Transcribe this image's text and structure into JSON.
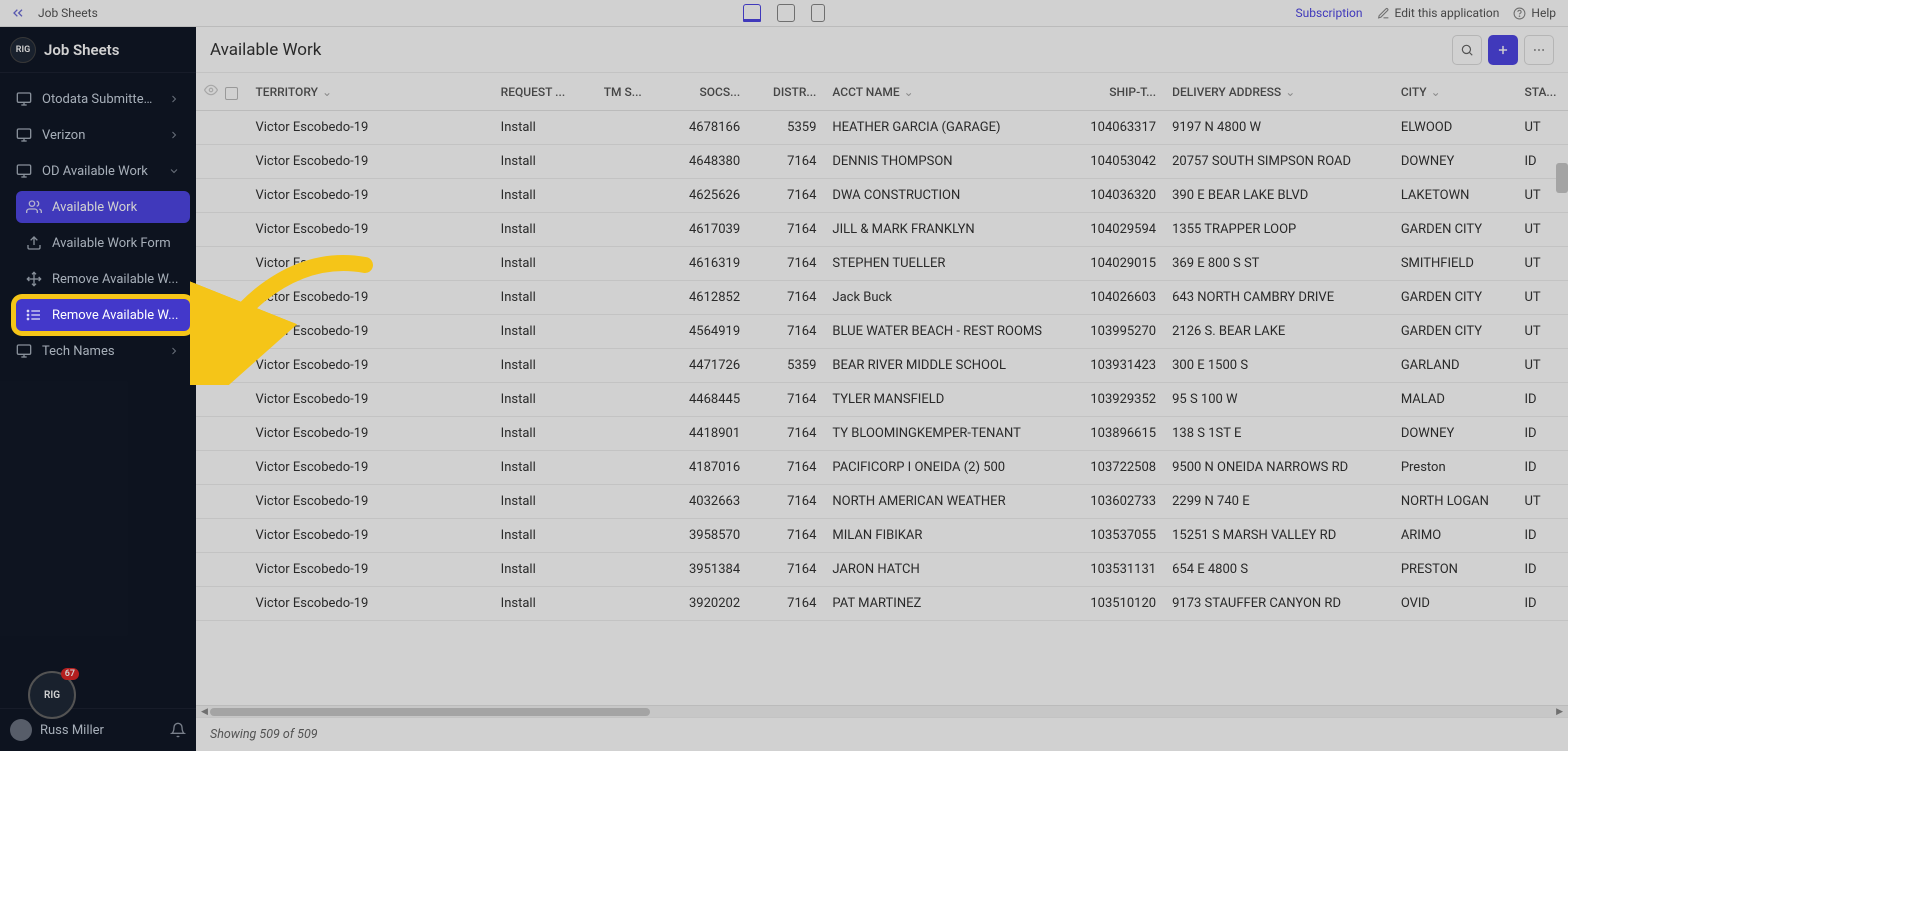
{
  "topbar": {
    "breadcrumb": "Job Sheets",
    "subscription": "Subscription",
    "edit": "Edit this application",
    "help": "Help"
  },
  "sidebar": {
    "logo_text": "RIG",
    "title": "Job Sheets",
    "items": [
      {
        "label": "Otodata Submitted ...",
        "icon": "monitor-icon",
        "has_chev": true
      },
      {
        "label": "Verizon",
        "icon": "monitor-icon",
        "has_chev": true
      },
      {
        "label": "OD Available Work",
        "icon": "monitor-icon",
        "has_chev": true,
        "expanded": true
      },
      {
        "label": "Available Work",
        "icon": "users-icon",
        "active": true,
        "indent": true
      },
      {
        "label": "Available Work Form",
        "icon": "upload-icon",
        "indent": true
      },
      {
        "label": "Remove Available W...",
        "icon": "move-icon",
        "indent": true
      },
      {
        "label": "Remove Available W...",
        "icon": "list-icon",
        "highlight": true,
        "indent": true
      },
      {
        "label": "Tech Names",
        "icon": "monitor-icon",
        "has_chev": true
      }
    ],
    "badge_count": "67",
    "badge_text": "RIG",
    "user_name": "Russ Miller"
  },
  "page": {
    "title": "Available Work",
    "footer": "Showing 509 of 509"
  },
  "columns": [
    "TERRITORY",
    "REQUEST ...",
    "TM S...",
    "SOCS...",
    "DISTR...",
    "ACCT NAME",
    "SHIP-T...",
    "DELIVERY ADDRESS",
    "CITY",
    "STA..."
  ],
  "rows": [
    {
      "territory": "Victor Escobedo-19",
      "request": "Install",
      "tms": "",
      "socs": "4678166",
      "distr": "5359",
      "acct": "HEATHER GARCIA (GARAGE)",
      "ship": "104063317",
      "addr": "9197 N 4800 W",
      "city": "ELWOOD",
      "sta": "UT"
    },
    {
      "territory": "Victor Escobedo-19",
      "request": "Install",
      "tms": "",
      "socs": "4648380",
      "distr": "7164",
      "acct": "DENNIS THOMPSON",
      "ship": "104053042",
      "addr": "20757 SOUTH SIMPSON ROAD",
      "city": "DOWNEY",
      "sta": "ID"
    },
    {
      "territory": "Victor Escobedo-19",
      "request": "Install",
      "tms": "",
      "socs": "4625626",
      "distr": "7164",
      "acct": "DWA CONSTRUCTION",
      "ship": "104036320",
      "addr": "390 E BEAR LAKE BLVD",
      "city": "LAKETOWN",
      "sta": "UT"
    },
    {
      "territory": "Victor Escobedo-19",
      "request": "Install",
      "tms": "",
      "socs": "4617039",
      "distr": "7164",
      "acct": "JILL & MARK FRANKLYN",
      "ship": "104029594",
      "addr": "1355 TRAPPER LOOP",
      "city": "GARDEN CITY",
      "sta": "UT"
    },
    {
      "territory": "Victor Escobedo-19",
      "request": "Install",
      "tms": "",
      "socs": "4616319",
      "distr": "7164",
      "acct": "STEPHEN TUELLER",
      "ship": "104029015",
      "addr": "369 E 800 S ST",
      "city": "SMITHFIELD",
      "sta": "UT"
    },
    {
      "territory": "Victor Escobedo-19",
      "request": "Install",
      "tms": "",
      "socs": "4612852",
      "distr": "7164",
      "acct": "Jack Buck",
      "ship": "104026603",
      "addr": "643 NORTH CAMBRY DRIVE",
      "city": "GARDEN CITY",
      "sta": "UT"
    },
    {
      "territory": "Victor Escobedo-19",
      "request": "Install",
      "tms": "",
      "socs": "4564919",
      "distr": "7164",
      "acct": "BLUE WATER BEACH - REST ROOMS",
      "ship": "103995270",
      "addr": "2126 S. BEAR LAKE",
      "city": "GARDEN CITY",
      "sta": "UT"
    },
    {
      "territory": "Victor Escobedo-19",
      "request": "Install",
      "tms": "",
      "socs": "4471726",
      "distr": "5359",
      "acct": "BEAR RIVER MIDDLE SCHOOL",
      "ship": "103931423",
      "addr": "300 E 1500 S",
      "city": "GARLAND",
      "sta": "UT"
    },
    {
      "territory": "Victor Escobedo-19",
      "request": "Install",
      "tms": "",
      "socs": "4468445",
      "distr": "7164",
      "acct": "TYLER MANSFIELD",
      "ship": "103929352",
      "addr": "95 S 100 W",
      "city": "MALAD",
      "sta": "ID"
    },
    {
      "territory": "Victor Escobedo-19",
      "request": "Install",
      "tms": "",
      "socs": "4418901",
      "distr": "7164",
      "acct": "TY BLOOMINGKEMPER-TENANT",
      "ship": "103896615",
      "addr": "138 S 1ST E",
      "city": "DOWNEY",
      "sta": "ID"
    },
    {
      "territory": "Victor Escobedo-19",
      "request": "Install",
      "tms": "",
      "socs": "4187016",
      "distr": "7164",
      "acct": "PACIFICORP I ONEIDA (2) 500",
      "ship": "103722508",
      "addr": "9500 N ONEIDA NARROWS RD",
      "city": "Preston",
      "sta": "ID"
    },
    {
      "territory": "Victor Escobedo-19",
      "request": "Install",
      "tms": "",
      "socs": "4032663",
      "distr": "7164",
      "acct": "NORTH AMERICAN WEATHER",
      "ship": "103602733",
      "addr": "2299 N 740 E",
      "city": "NORTH LOGAN",
      "sta": "UT"
    },
    {
      "territory": "Victor Escobedo-19",
      "request": "Install",
      "tms": "",
      "socs": "3958570",
      "distr": "7164",
      "acct": "MILAN FIBIKAR",
      "ship": "103537055",
      "addr": "15251 S MARSH VALLEY RD",
      "city": "ARIMO",
      "sta": "ID"
    },
    {
      "territory": "Victor Escobedo-19",
      "request": "Install",
      "tms": "",
      "socs": "3951384",
      "distr": "7164",
      "acct": "JARON HATCH",
      "ship": "103531131",
      "addr": "654 E 4800 S",
      "city": "PRESTON",
      "sta": "ID"
    },
    {
      "territory": "Victor Escobedo-19",
      "request": "Install",
      "tms": "",
      "socs": "3920202",
      "distr": "7164",
      "acct": "PAT MARTINEZ",
      "ship": "103510120",
      "addr": "9173 STAUFFER CANYON RD",
      "city": "OVID",
      "sta": "ID"
    }
  ]
}
